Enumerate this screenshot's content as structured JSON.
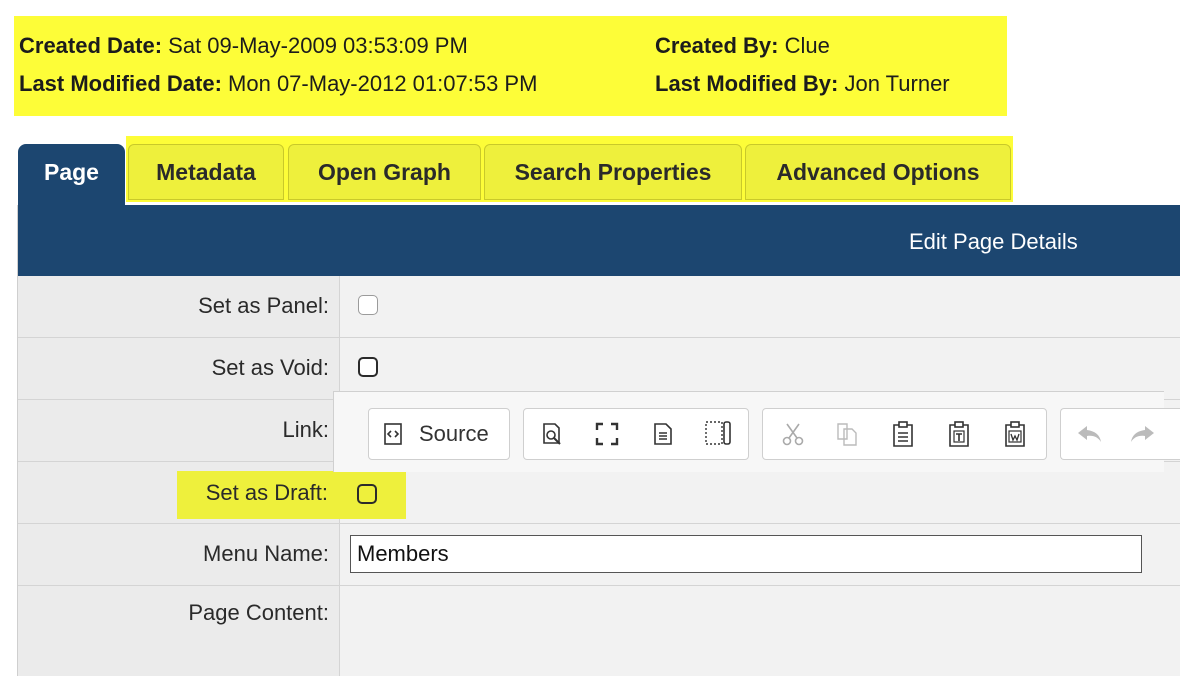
{
  "meta": {
    "created_date_label": "Created Date:",
    "created_date_value": "Sat 09-May-2009 03:53:09 PM",
    "last_modified_date_label": "Last Modified Date:",
    "last_modified_date_value": "Mon 07-May-2012 01:07:53 PM",
    "created_by_label": "Created By:",
    "created_by_value": "Clue",
    "last_modified_by_label": "Last Modified By:",
    "last_modified_by_value": "Jon Turner"
  },
  "tabs": [
    {
      "label": "Page",
      "active": true
    },
    {
      "label": "Metadata",
      "active": false
    },
    {
      "label": "Open Graph",
      "active": false
    },
    {
      "label": "Search Properties",
      "active": false
    },
    {
      "label": "Advanced Options",
      "active": false
    }
  ],
  "panel": {
    "title": "Edit Page Details",
    "fields": {
      "set_as_panel": {
        "label": "Set as Panel:",
        "checked": false
      },
      "set_as_void": {
        "label": "Set as Void:",
        "checked": false
      },
      "link": {
        "label": "Link:",
        "checked": false
      },
      "set_as_draft": {
        "label": "Set as Draft:",
        "checked": false
      },
      "menu_name": {
        "label": "Menu Name:",
        "value": "Members"
      },
      "page_content": {
        "label": "Page Content:"
      }
    }
  },
  "editor_toolbar": {
    "source_label": "Source",
    "icons": [
      "source-icon",
      "preview-icon",
      "maximize-icon",
      "new-page-icon",
      "templates-icon",
      "cut-icon",
      "copy-icon",
      "paste-icon",
      "paste-text-icon",
      "paste-word-icon",
      "undo-icon",
      "redo-icon"
    ]
  },
  "colors": {
    "highlight": "#fdfd38",
    "header_blue": "#1c4670",
    "label_bg": "#ebebeb"
  }
}
